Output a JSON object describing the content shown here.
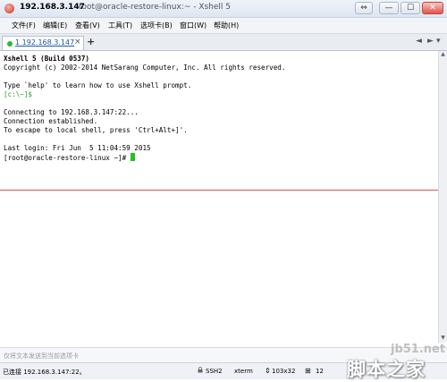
{
  "window": {
    "title_host": "192.168.3.147",
    "title_full": "root@oracle-restore-linux:~ - Xshell 5",
    "controls": [
      "⇔",
      "—",
      "☐",
      "✕"
    ]
  },
  "menu": [
    "文件(F)",
    "编辑(E)",
    "查看(V)",
    "工具(T)",
    "选项卡(B)",
    "窗口(W)",
    "帮助(H)"
  ],
  "tabs": {
    "items": [
      {
        "label": "1 192.168.3.147",
        "close": "×"
      }
    ],
    "add": "+",
    "prev": "◄",
    "next": "►",
    "menu": "▾"
  },
  "terminal": {
    "lines": [
      "Xshell 5 (Build 0537)",
      "Copyright (c) 2002-2014 NetSarang Computer, Inc. All rights reserved.",
      "",
      "Type `help' to learn how to use Xshell prompt.",
      "[c:\\~]$",
      "",
      "Connecting to 192.168.3.147:22...",
      "Connection established.",
      "To escape to local shell, press 'Ctrl+Alt+]'.",
      "",
      "Last login: Fri Jun  5 11:04:59 2015",
      "[root@oracle-restore-linux ~]# "
    ],
    "colors": {
      "local_prompt": "#1ea51e",
      "cursor": "#22c322",
      "divider": "#e05050"
    }
  },
  "compose": {
    "placeholder": "仅将文本发送到当前选项卡"
  },
  "status": {
    "connected": "已连接 192.168.3.147:22。",
    "protocol": "SSH2",
    "terminal_type": "xterm",
    "size": "103x32",
    "extra": "12"
  },
  "watermark": {
    "site": "jb51.net",
    "name": "脚本之家"
  }
}
